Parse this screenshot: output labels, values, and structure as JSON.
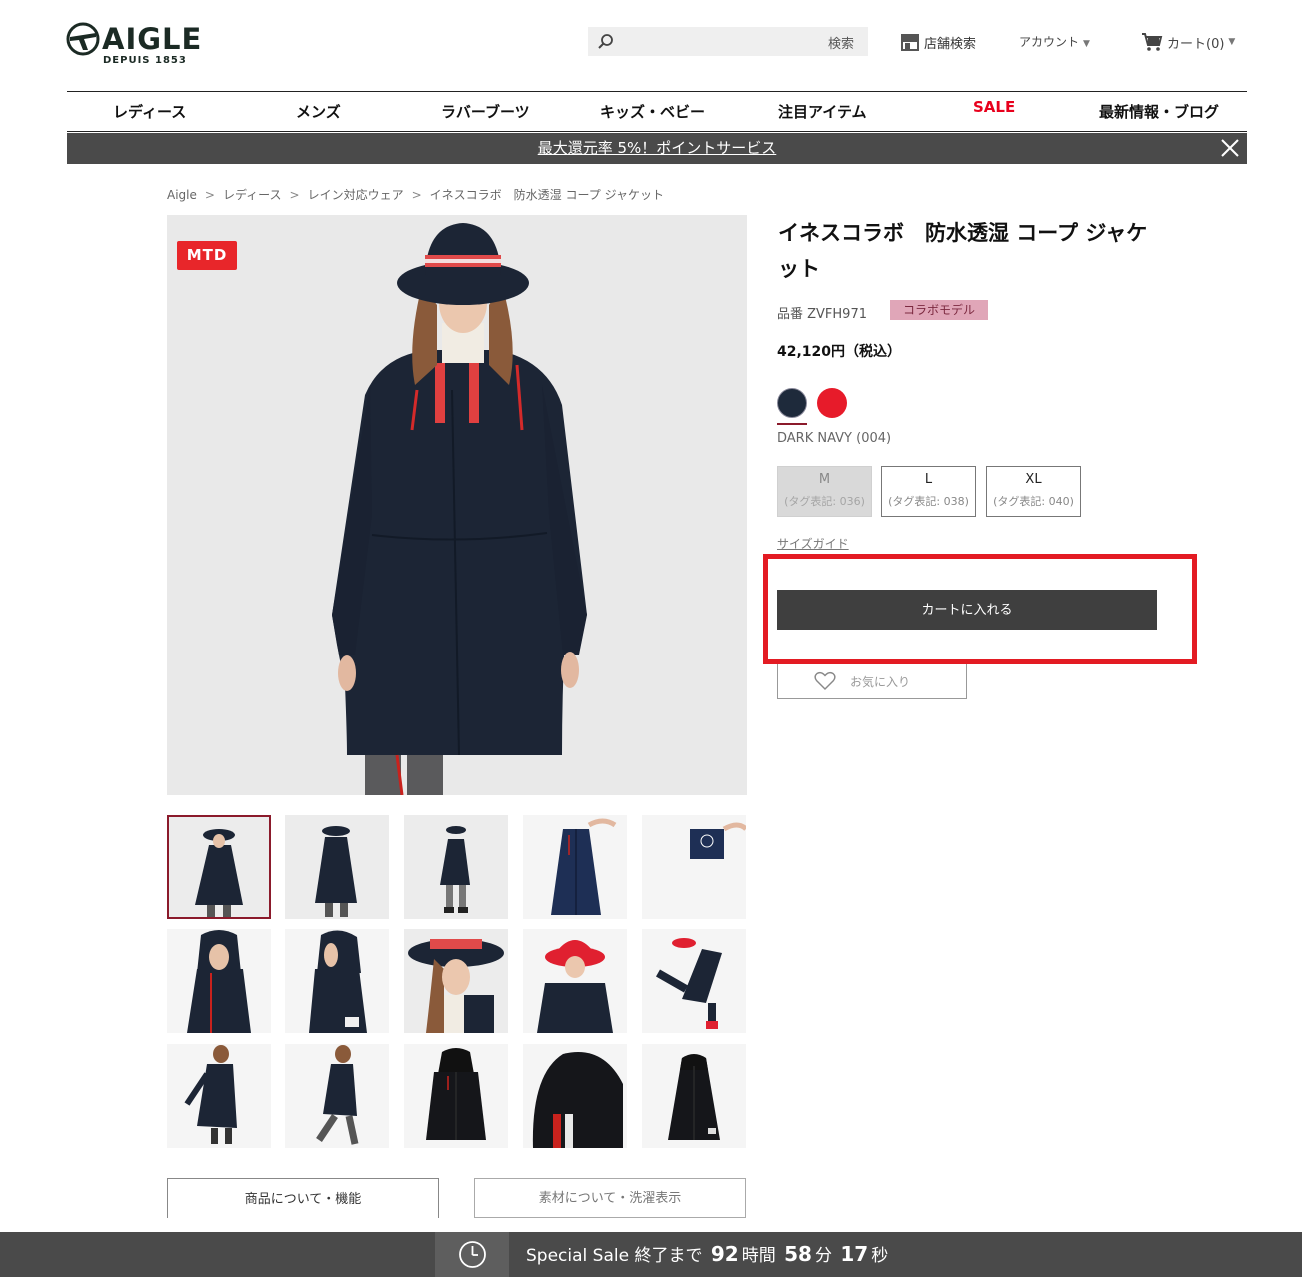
{
  "brand": {
    "name": "AIGLE",
    "tagline": "DEPUIS 1853"
  },
  "header": {
    "search_button": "検索",
    "search_placeholder": "",
    "store_search": "店舗検索",
    "account": "アカウント",
    "cart": "カート(0)"
  },
  "nav": {
    "items": [
      "レディース",
      "メンズ",
      "ラバーブーツ",
      "キッズ・ベビー",
      "注目アイテム",
      "SALE",
      "最新情報・ブログ"
    ]
  },
  "promo": {
    "text": "最大還元率 5%！ポイントサービス"
  },
  "breadcrumb": [
    "Aigle",
    "レディース",
    "レイン対応ウェア",
    "イネスコラボ　防水透湿 コープ ジャケット"
  ],
  "product": {
    "badge": "MTD",
    "title": "イネスコラボ　防水透湿 コープ ジャケット",
    "sku": "品番 ZVFH971",
    "collab_badge": "コラボモデル",
    "price": "42,120円（税込）",
    "color_name": "DARK NAVY (004)",
    "colors": [
      "#1e2a3b",
      "#e71b2a"
    ],
    "sizes": [
      {
        "size": "M",
        "tag": "(タグ表記: 036)",
        "available": false
      },
      {
        "size": "L",
        "tag": "(タグ表記: 038)",
        "available": true
      },
      {
        "size": "XL",
        "tag": "(タグ表記: 040)",
        "available": true
      }
    ],
    "size_guide": "サイズガイド",
    "add_to_cart": "カートに入れる",
    "favorite": "お気に入り"
  },
  "tabs": [
    "商品について・機能",
    "素材について・洗濯表示"
  ],
  "sale_bar": {
    "label": "Special Sale",
    "until": "終了まで",
    "hours": "92",
    "hours_unit": "時間",
    "minutes": "58",
    "minutes_unit": "分",
    "seconds": "17",
    "seconds_unit": "秒"
  },
  "colors": {
    "accent": "#e31b23",
    "dark_bar": "#4a4a4a",
    "navy": "#1e2a3b",
    "sale_red": "#e8001c"
  }
}
